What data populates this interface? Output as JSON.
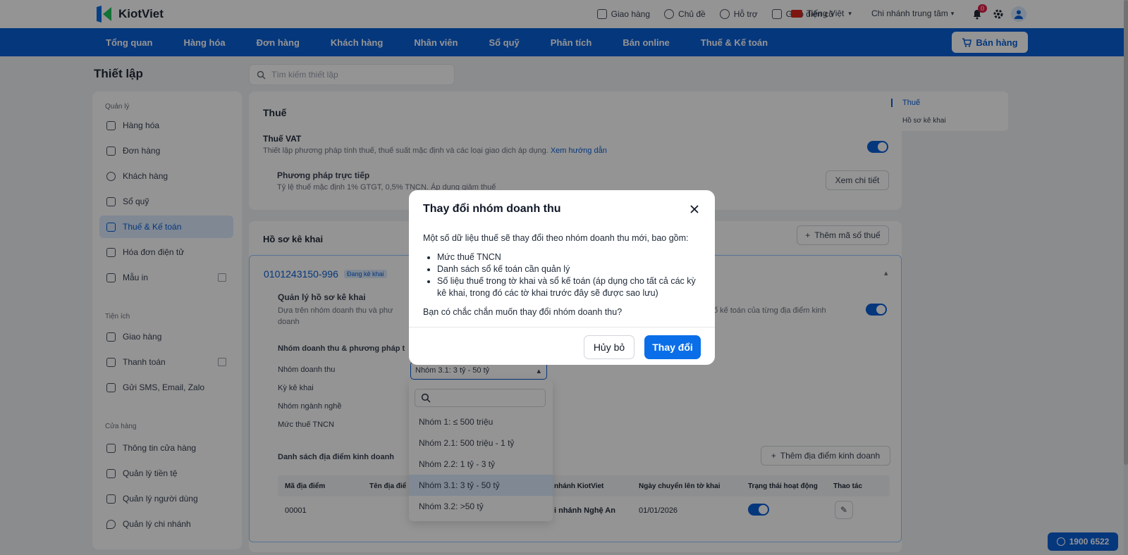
{
  "app": {
    "brand": "KiotViet"
  },
  "topbar": {
    "links": [
      "Giao hàng",
      "Chủ đề",
      "Hỗ trợ",
      "Giao diện cũ",
      "Tiếng Việt",
      "Chi nhánh trung tâm"
    ],
    "notif_count": "0"
  },
  "nav": {
    "items": [
      "Tổng quan",
      "Hàng hóa",
      "Đơn hàng",
      "Khách hàng",
      "Nhân viên",
      "Sổ quỹ",
      "Phân tích",
      "Bán online",
      "Thuế & Kế toán"
    ],
    "sell_label": "Bán hàng"
  },
  "page": {
    "title": "Thiết lập",
    "search_placeholder": "Tìm kiếm thiết lập"
  },
  "sidebar": {
    "groups": [
      {
        "label": "Quản lý",
        "items": [
          "Hàng hóa",
          "Đơn hàng",
          "Khách hàng",
          "Sổ quỹ",
          "Thuế & Kế toán",
          "Hóa đơn điện tử",
          "Mẫu in"
        ]
      },
      {
        "label": "Tiện ích",
        "items": [
          "Giao hàng",
          "Thanh toán",
          "Gửi SMS, Email, Zalo"
        ]
      },
      {
        "label": "Cửa hàng",
        "items": [
          "Thông tin cửa hàng",
          "Quản lý tiền tệ",
          "Quản lý người dùng",
          "Quản lý chi nhánh"
        ]
      }
    ],
    "active": "Thuế & Kế toán"
  },
  "tax": {
    "heading": "Thuế",
    "vat_title": "Thuế VAT",
    "vat_desc": "Thiết lập phương pháp tính thuế, thuế suất mặc định và các loại giao dịch áp dụng.",
    "vat_link": "Xem hướng dẫn",
    "method_title": "Phương pháp trực tiếp",
    "method_desc": "Tỷ lệ thuế mặc định 1% GTGT, 0,5% TNCN. Áp dụng giảm thuế",
    "detail_btn": "Xem chi tiết"
  },
  "profile": {
    "heading": "Hồ sơ kê khai",
    "add_btn": "Thêm mã số thuế",
    "tax_code": "0101243150-996",
    "status": "Đang kê khai",
    "manage_title": "Quản lý hồ sơ kê khai",
    "manage_desc_left": "Dựa trên nhóm doanh thu và phư",
    "manage_desc_left2": "doanh",
    "manage_desc_right": "ổ kế toán của từng địa điểm kinh",
    "group_section": "Nhóm doanh thu & phương pháp t",
    "fields": [
      "Nhóm doanh thu",
      "Kỳ kê khai",
      "Nhóm ngành nghề",
      "Mức thuế TNCN"
    ],
    "selected_group": "Nhóm 3.1: 3 tỷ - 50 tỷ",
    "locations_title": "Danh sách địa điểm kinh doanh",
    "add_location_btn": "Thêm địa điểm kinh doanh",
    "table_headers": [
      "Mã địa điểm",
      "Tên địa điể",
      "nhánh KiotViet",
      "Ngày chuyển lên tờ khai",
      "Trạng thái hoạt động",
      "Thao tác"
    ],
    "rows": [
      {
        "code": "00001",
        "branch": "i nhánh Nghệ An",
        "date": "01/01/2026"
      }
    ]
  },
  "rightnav": {
    "items": [
      "Thuế",
      "Hồ sơ kê khai"
    ]
  },
  "dropdown": {
    "options": [
      "Nhóm 1: ≤ 500 triệu",
      "Nhóm 2.1: 500 triệu - 1 tỷ",
      "Nhóm 2.2: 1 tỷ - 3 tỷ",
      "Nhóm 3.1: 3 tỷ - 50 tỷ",
      "Nhóm 3.2: >50 tỷ"
    ],
    "selected_index": 3
  },
  "modal": {
    "title": "Thay đổi nhóm doanh thu",
    "intro": "Một số dữ liệu thuế sẽ thay đổi theo nhóm doanh thu mới, bao gồm:",
    "bullets": [
      "Mức thuế TNCN",
      "Danh sách sổ kế toán cần quản lý",
      "Số liệu thuế trong tờ khai và sổ kế toán (áp dụng cho tất cả các kỳ kê khai, trong đó các tờ khai trước đây sẽ được sao lưu)"
    ],
    "question": "Bạn có chắc chắn muốn thay đổi nhóm doanh thu?",
    "cancel": "Hủy bỏ",
    "confirm": "Thay đổi"
  },
  "hotline": "1900 6522",
  "colors": {
    "primary": "#0a5fd8",
    "confirm": "#0a6ee8"
  }
}
